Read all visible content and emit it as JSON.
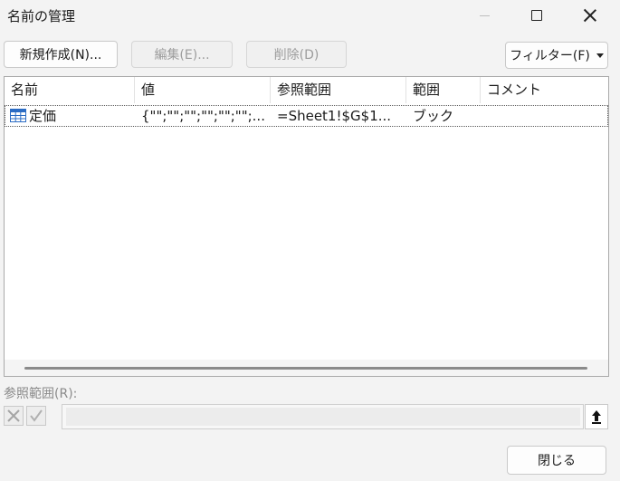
{
  "window": {
    "title": "名前の管理"
  },
  "toolbar": {
    "new_label": "新規作成(N)...",
    "edit_label": "編集(E)...",
    "delete_label": "削除(D)",
    "filter_label": "フィルター(F)"
  },
  "table": {
    "headers": [
      "名前",
      "値",
      "参照範囲",
      "範囲",
      "コメント"
    ],
    "rows": [
      {
        "name": "定価",
        "value": "{\"\";\"\";\"\";\"\";\"\";\"\";...",
        "refers_to": "=Sheet1!$G$1...",
        "scope": "ブック",
        "comment": ""
      }
    ]
  },
  "refers_to": {
    "label": "参照範囲(R):",
    "value": ""
  },
  "footer": {
    "close_label": "閉じる"
  },
  "colors": {
    "background": "#f3f3f3",
    "list_background": "#ffffff",
    "table_icon_blue": "#2b6cc4"
  },
  "icons": {
    "table": "table-icon",
    "cancel": "x-icon",
    "confirm": "check-icon",
    "collapse": "collapse-dialog-icon",
    "dropdown": "dropdown-caret-icon"
  }
}
